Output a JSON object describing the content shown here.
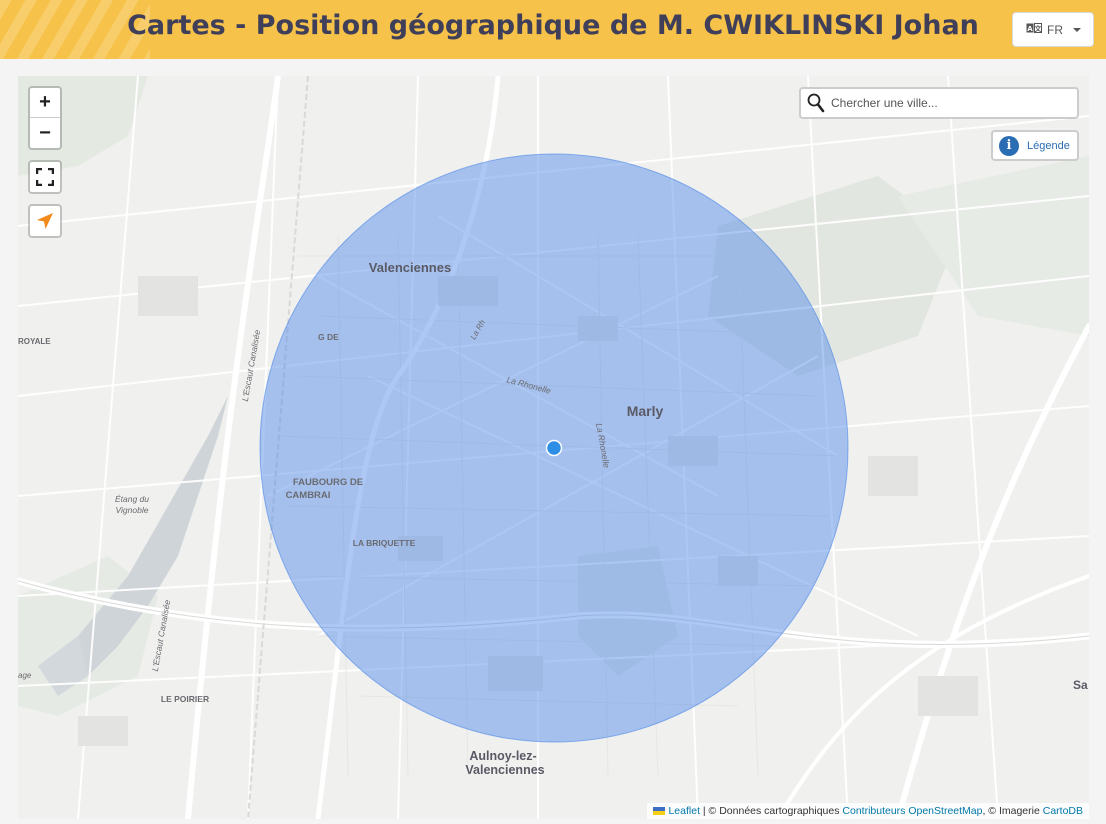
{
  "header": {
    "title": "Cartes - Position géographique de M. CWIKLINSKI Johan",
    "lang_label": "FR",
    "lang_icon": "translate-icon"
  },
  "map": {
    "zoom_in": "+",
    "zoom_out": "−",
    "search_placeholder": "Chercher une ville...",
    "legend_label": "Légende",
    "circle_color": "#4a86e8",
    "marker_color": "#2d8ee6",
    "place_labels": {
      "valenciennes": "Valenciennes",
      "marly": "Marly",
      "faubourg": "FAUBOURG DE",
      "cambrai": "CAMBRAI",
      "briquette": "LA BRIQUETTE",
      "poirier": "LE POIRIER",
      "aulnoy1": "Aulnoy-lez-",
      "aulnoy2": "Valenciennes",
      "etang1": "Étang du",
      "etang2": "Vignoble",
      "royale": "ROYALE",
      "gde": "G DE",
      "rhonelle1": "La Rhonelle",
      "rhonelle2": "La Rhonelle",
      "escaut": "L'Escaut Canalisée",
      "escaut2": "L'Escaut Canalisée",
      "sa": "Sa",
      "age": "age",
      "rh3": "La Rh"
    },
    "attribution": {
      "leaflet": "Leaflet",
      "sep1": " | © Données cartographiques ",
      "osm": "Contributeurs OpenStreetMap",
      "sep2": ", © Imagerie ",
      "cartodb": "CartoDB"
    }
  }
}
